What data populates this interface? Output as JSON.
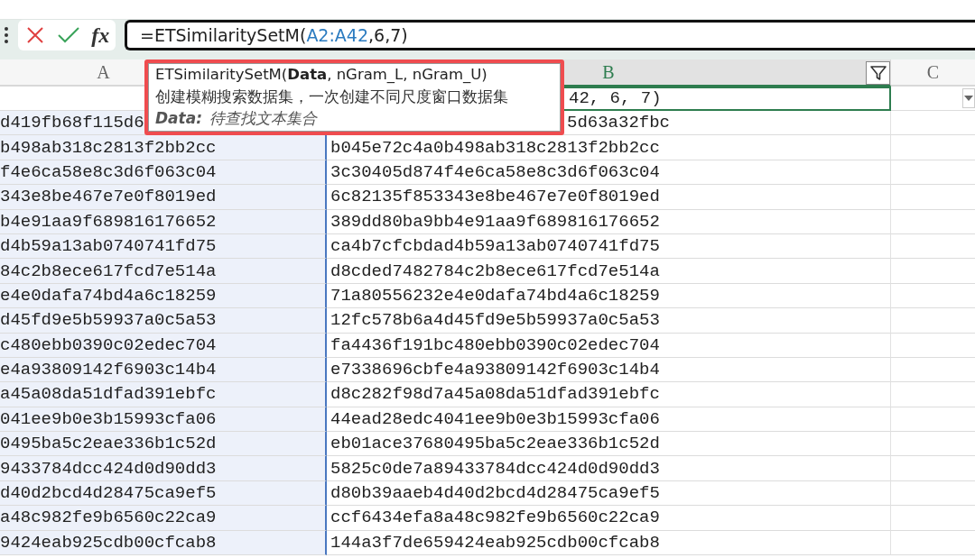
{
  "formula_bar": {
    "fx_label": "fx",
    "formula": [
      {
        "kind": "plain",
        "text": "=ETSimilaritySetM("
      },
      {
        "kind": "reference",
        "text": "A2:A42"
      },
      {
        "kind": "plain",
        "text": ",6,7)"
      }
    ]
  },
  "columns": [
    {
      "label": "A",
      "selected": false,
      "highlighted": true,
      "filter": false
    },
    {
      "label": "B",
      "selected": true,
      "highlighted": false,
      "filter": true
    },
    {
      "label": "C",
      "selected": false,
      "highlighted": false,
      "filter": false
    }
  ],
  "first_row": {
    "column_b": "42, 6, 7)",
    "column_c_dropdown": true
  },
  "rows": [
    {
      "a": "d419fb68f115d6",
      "b": "5d63a32fbc",
      "covered": true
    },
    {
      "a": "b498ab318c2813f2bb2cc",
      "b": "b045e72c4a0b498ab318c2813f2bb2cc",
      "covered": false
    },
    {
      "a": "f4e6ca58e8c3d6f063c04",
      "b": "3c30405d874f4e6ca58e8c3d6f063c04",
      "covered": false
    },
    {
      "a": "343e8be467e7e0f8019ed",
      "b": "6c82135f853343e8be467e7e0f8019ed",
      "covered": false
    },
    {
      "a": "b4e91aa9f689816176652",
      "b": "389dd80ba9bb4e91aa9f689816176652",
      "covered": false
    },
    {
      "a": "d4b59a13ab0740741fd75",
      "b": "ca4b7cfcbdad4b59a13ab0740741fd75",
      "covered": false
    },
    {
      "a": "84c2b8ece617fcd7e514a",
      "b": "d8cded7482784c2b8ece617fcd7e514a",
      "covered": false
    },
    {
      "a": "e4e0dafa74bd4a6c18259",
      "b": "71a80556232e4e0dafa74bd4a6c18259",
      "covered": false
    },
    {
      "a": "d45fd9e5b59937a0c5a53",
      "b": "12fc578b6a4d45fd9e5b59937a0c5a53",
      "covered": false
    },
    {
      "a": "c480ebb0390c02edec704",
      "b": "fa4436f191bc480ebb0390c02edec704",
      "covered": false
    },
    {
      "a": "e4a93809142f6903c14b4",
      "b": "e7338696cbfe4a93809142f6903c14b4",
      "covered": false
    },
    {
      "a": "a45a08da51dfad391ebfc",
      "b": "d8c282f98d7a45a08da51dfad391ebfc",
      "covered": false
    },
    {
      "a": "041ee9b0e3b15993cfa06",
      "b": "44ead28edc4041ee9b0e3b15993cfa06",
      "covered": false
    },
    {
      "a": "0495ba5c2eae336b1c52d",
      "b": "eb01ace37680495ba5c2eae336b1c52d",
      "covered": false
    },
    {
      "a": "9433784dcc424d0d90dd3",
      "b": "5825c0de7a89433784dcc424d0d90dd3",
      "covered": false
    },
    {
      "a": "d40d2bcd4d28475ca9ef5",
      "b": "d80b39aaeb4d40d2bcd4d28475ca9ef5",
      "covered": false
    },
    {
      "a": "a48c982fe9b6560c22ca9",
      "b": "ccf6434efa8a48c982fe9b6560c22ca9",
      "covered": false
    },
    {
      "a": "9424eab925cdb00cfcab8",
      "b": "144a3f7de659424eab925cdb00cfcab8",
      "covered": false
    }
  ],
  "tooltip": {
    "signature": "ETSimilaritySetM(**Data**, nGram_L, nGram_U)",
    "description": "创建模糊搜索数据集，一次创建不同尺度窗口数据集",
    "param_name": "Data:",
    "param_text": "待查找文本集合"
  }
}
